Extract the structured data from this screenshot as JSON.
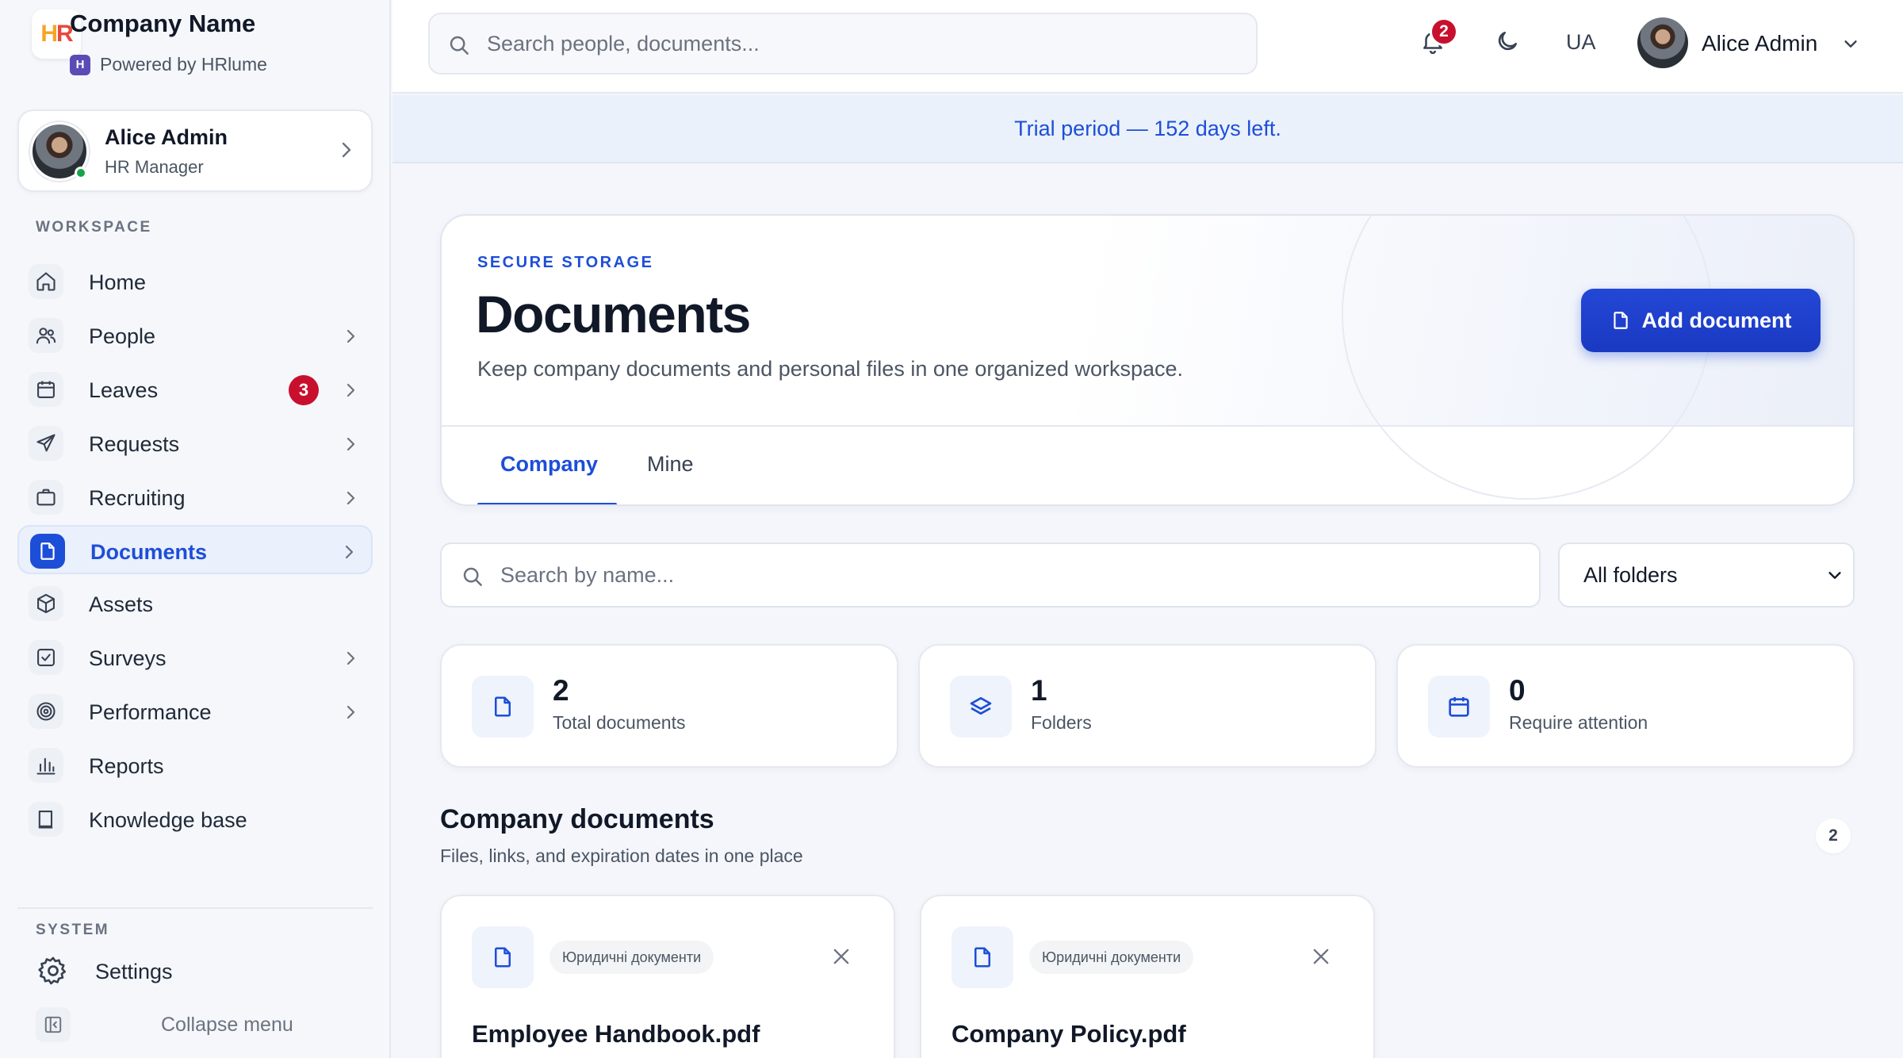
{
  "brand": {
    "logo_h": "H",
    "logo_r": "R",
    "name": "Company Name",
    "powered_by": "Powered by HRlume"
  },
  "current_user": {
    "name": "Alice Admin",
    "role": "HR Manager"
  },
  "sidebar": {
    "workspace_label": "WORKSPACE",
    "items": [
      {
        "label": "Home",
        "icon": "home-icon"
      },
      {
        "label": "People",
        "icon": "people-icon"
      },
      {
        "label": "Leaves",
        "icon": "calendar-icon",
        "badge": "3"
      },
      {
        "label": "Requests",
        "icon": "send-icon"
      },
      {
        "label": "Recruiting",
        "icon": "briefcase-icon"
      },
      {
        "label": "Documents",
        "icon": "document-icon",
        "active": true
      },
      {
        "label": "Assets",
        "icon": "cube-icon"
      },
      {
        "label": "Surveys",
        "icon": "checkbox-icon"
      },
      {
        "label": "Performance",
        "icon": "target-icon"
      },
      {
        "label": "Reports",
        "icon": "bar-chart-icon"
      },
      {
        "label": "Knowledge base",
        "icon": "book-icon"
      }
    ],
    "system_label": "SYSTEM",
    "settings_label": "Settings",
    "collapse_label": "Collapse menu"
  },
  "topbar": {
    "search_placeholder": "Search people, documents...",
    "notification_count": "2",
    "language": "UA",
    "user_name": "Alice Admin"
  },
  "trial_banner": "Trial period — 152 days left.",
  "hero": {
    "eyebrow": "SECURE STORAGE",
    "title": "Documents",
    "description": "Keep company documents and personal files in one organized workspace.",
    "add_button": "Add document",
    "tabs": [
      {
        "label": "Company",
        "active": true
      },
      {
        "label": "Mine",
        "active": false
      }
    ]
  },
  "filters": {
    "search_placeholder": "Search by name...",
    "folder_selected": "All folders"
  },
  "stats": [
    {
      "value": "2",
      "label": "Total documents",
      "icon": "document-icon"
    },
    {
      "value": "1",
      "label": "Folders",
      "icon": "layers-icon"
    },
    {
      "value": "0",
      "label": "Require attention",
      "icon": "calendar-icon"
    }
  ],
  "company_documents": {
    "title": "Company documents",
    "subtitle": "Files, links, and expiration dates in one place",
    "count": "2",
    "items": [
      {
        "tag": "Юридичні документи",
        "name": "Employee Handbook.pdf"
      },
      {
        "tag": "Юридичні документи",
        "name": "Company Policy.pdf"
      }
    ]
  },
  "colors": {
    "accent": "#1d4ed8",
    "badge": "#c8102e",
    "online": "#16a34a"
  }
}
